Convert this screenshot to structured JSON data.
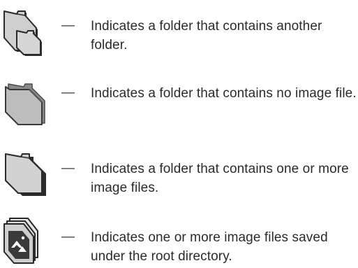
{
  "legend": {
    "items": [
      {
        "icon": "folder-containing-folder-icon",
        "dash": "—",
        "text": "Indicates a folder that contains another folder."
      },
      {
        "icon": "empty-folder-icon",
        "dash": "—",
        "text": "Indicates a folder that contains no image file."
      },
      {
        "icon": "folder-with-images-icon",
        "dash": "—",
        "text": "Indicates a folder that contains one or more image files."
      },
      {
        "icon": "root-image-files-icon",
        "dash": "—",
        "text": "Indicates one or more image files saved under the root directory."
      }
    ]
  }
}
